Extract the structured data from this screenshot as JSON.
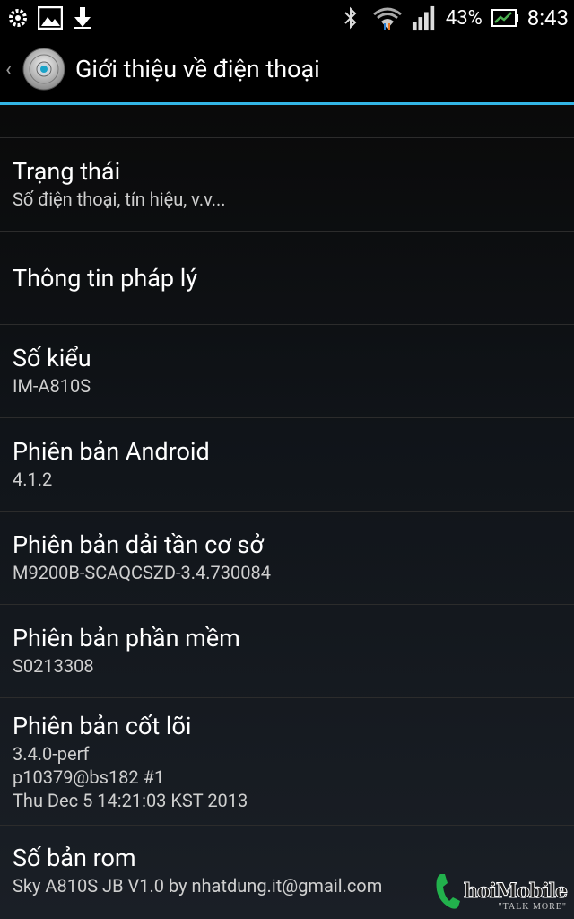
{
  "status_bar": {
    "battery_percent": "43%",
    "time": "8:43",
    "icons": [
      "settings-notification-icon",
      "image-notification-icon",
      "download-icon",
      "bluetooth-icon",
      "wifi-icon",
      "signal-icon",
      "battery-icon"
    ]
  },
  "action_bar": {
    "title": "Giới thiệu về điện thoại",
    "accent": "#33b5e5"
  },
  "items": [
    {
      "title": "Trạng thái",
      "summary": "Số điện thoại, tín hiệu, v.v..."
    },
    {
      "title": "Thông tin pháp lý"
    },
    {
      "title": "Số kiểu",
      "summary": "IM-A810S"
    },
    {
      "title": "Phiên bản Android",
      "summary": "4.1.2"
    },
    {
      "title": "Phiên bản dải tần cơ sở",
      "summary": "M9200B-SCAQCSZD-3.4.730084"
    },
    {
      "title": "Phiên bản phần mềm",
      "summary": "S0213308"
    },
    {
      "title": "Phiên bản cốt lõi",
      "summary": "3.4.0-perf\np10379@bs182 #1\nThu Dec 5 14:21:03 KST 2013"
    },
    {
      "title": "Số bản rom",
      "summary": "Sky A810S JB V1.0 by nhatdung.it@gmail.com"
    }
  ],
  "watermark": {
    "brand": "hoiMobile",
    "tagline": "\"TALK MORE\""
  }
}
